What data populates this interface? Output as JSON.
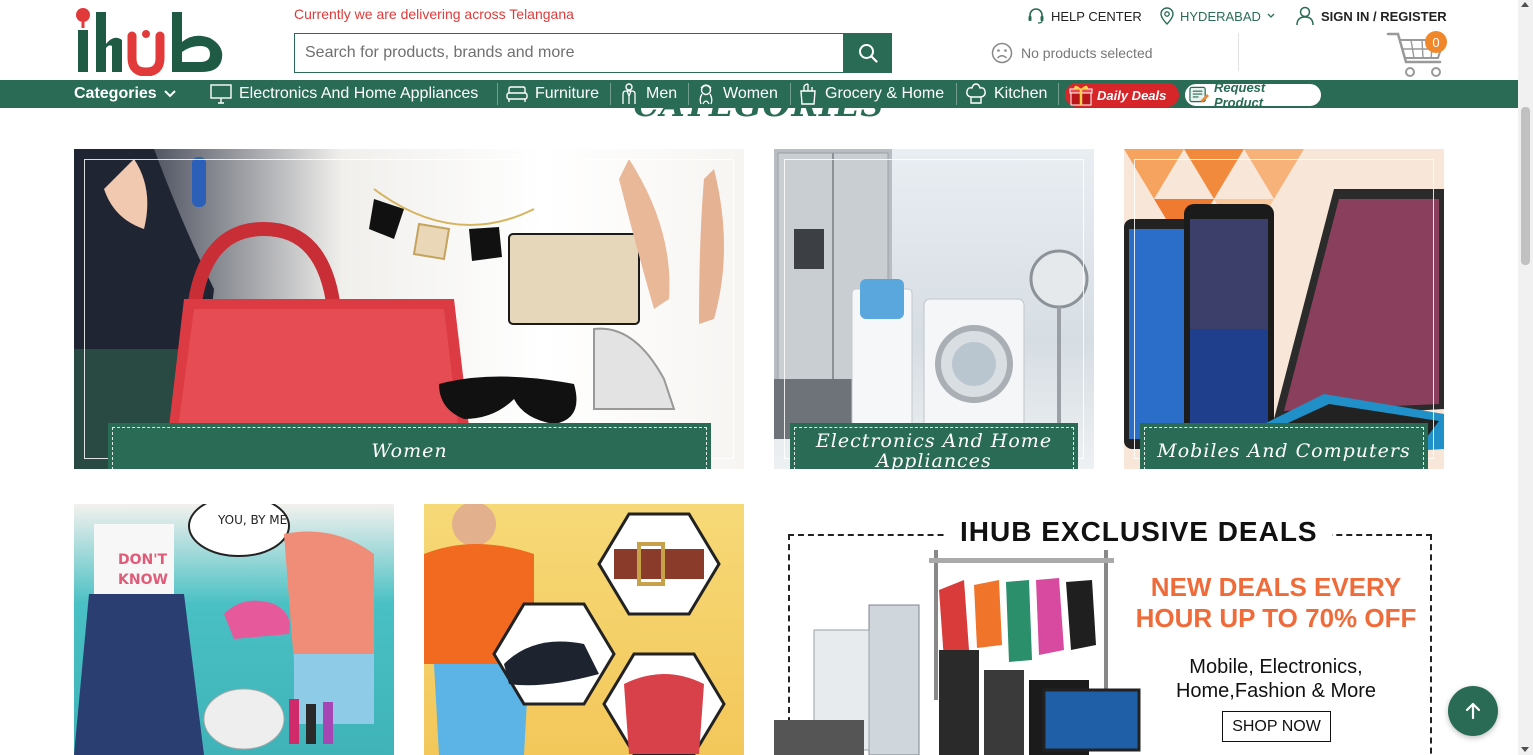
{
  "brand": {
    "name": "ihub"
  },
  "colors": {
    "primary": "#2a6b56",
    "accent": "#f1872b",
    "deals_red": "#d7262a",
    "delivery_red": "#e03a3a",
    "promo_orange": "#ef6b3a"
  },
  "header": {
    "delivery_notice": "Currently we are delivering across Telangana",
    "search": {
      "placeholder": "Search for products, brands and more",
      "value": "",
      "button_icon": "search-icon"
    },
    "help_center": "HELP CENTER",
    "location": "HYDERABAD",
    "sign_in": "SIGN IN / REGISTER",
    "no_products": "No products selected",
    "cart_count": "0"
  },
  "nav": {
    "categories_label": "Categories",
    "items": [
      {
        "label": "Electronics And Home Appliances",
        "icon": "monitor-icon"
      },
      {
        "label": "Furniture",
        "icon": "sofa-icon"
      },
      {
        "label": "Men",
        "icon": "man-icon"
      },
      {
        "label": "Women",
        "icon": "woman-icon"
      },
      {
        "label": "Grocery & Home",
        "icon": "grocery-bag-icon"
      },
      {
        "label": "Kitchen",
        "icon": "chef-hat-icon"
      }
    ],
    "daily_deals": "Daily Deals",
    "request_product": "Request Product"
  },
  "section_heading": "CATEGORIES",
  "tiles": [
    {
      "label": "Women"
    },
    {
      "label": "Electronics And Home Appliances"
    },
    {
      "label": "Mobiles And Computers"
    }
  ],
  "promo": {
    "title": "IHUB EXCLUSIVE DEALS",
    "headline": "NEW DEALS EVERY HOUR UP TO 70% OFF",
    "sub": "Mobile, Electronics, Home,Fashion & More",
    "cta": "SHOP NOW"
  }
}
